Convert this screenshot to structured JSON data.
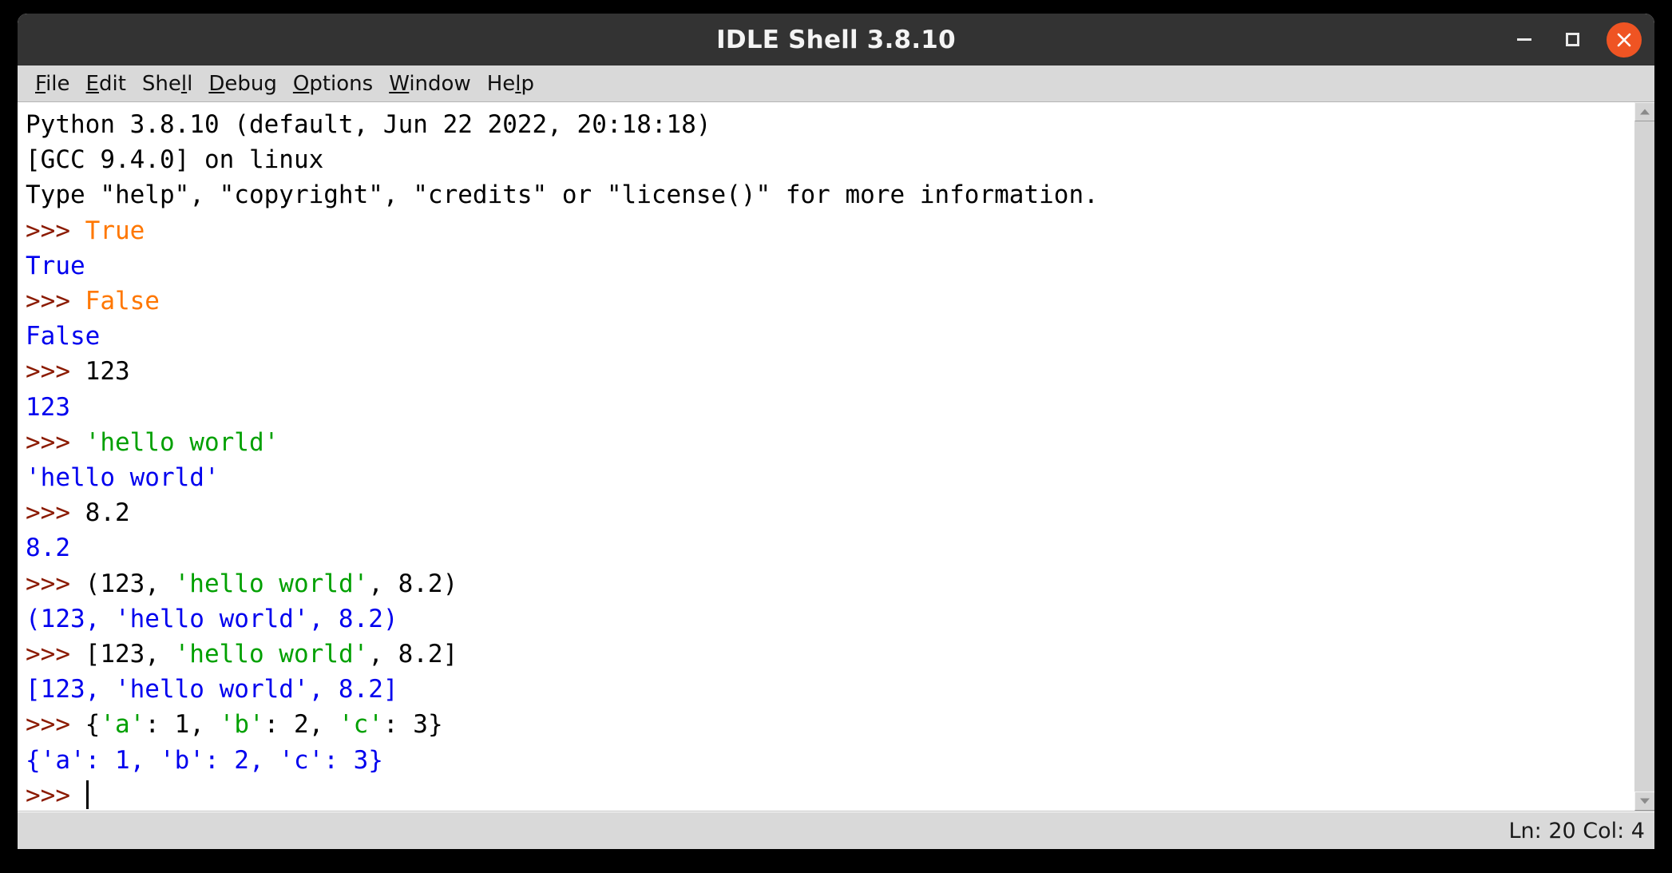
{
  "window": {
    "title": "IDLE Shell 3.8.10",
    "controls": {
      "minimize_label": "Minimize",
      "maximize_label": "Maximize",
      "close_label": "Close"
    },
    "colors": {
      "titlebar_bg": "#333333",
      "titlebar_fg": "#f4f4f4",
      "close_button": "#ef5423",
      "chrome_bg": "#d9d9d9",
      "text_bg": "#ffffff"
    }
  },
  "menubar": {
    "items": [
      {
        "label": "File",
        "pre": "",
        "mnemonic": "F",
        "post": "ile"
      },
      {
        "label": "Edit",
        "pre": "",
        "mnemonic": "E",
        "post": "dit"
      },
      {
        "label": "Shell",
        "pre": "She",
        "mnemonic": "l",
        "post": "l"
      },
      {
        "label": "Debug",
        "pre": "",
        "mnemonic": "D",
        "post": "ebug"
      },
      {
        "label": "Options",
        "pre": "",
        "mnemonic": "O",
        "post": "ptions"
      },
      {
        "label": "Window",
        "pre": "",
        "mnemonic": "W",
        "post": "indow"
      },
      {
        "label": "Help",
        "pre": "He",
        "mnemonic": "l",
        "post": "p"
      }
    ]
  },
  "shell": {
    "syntax_colors": {
      "prompt": "#8b1a00",
      "keyword": "#ff7700",
      "string": "#00a000",
      "output": "#0000ee",
      "default": "#000000"
    },
    "lines": [
      {
        "id": "banner-1",
        "spans": [
          {
            "text": "Python 3.8.10 (default, Jun 22 2022, 20:18:18)",
            "color": "default"
          }
        ]
      },
      {
        "id": "banner-2",
        "spans": [
          {
            "text": "[GCC 9.4.0] on linux",
            "color": "default"
          }
        ]
      },
      {
        "id": "banner-3",
        "spans": [
          {
            "text": "Type \"help\", \"copyright\", \"credits\" or \"license()\" for more information.",
            "color": "default"
          }
        ]
      },
      {
        "id": "input-true",
        "spans": [
          {
            "text": ">>> ",
            "color": "prompt"
          },
          {
            "text": "True",
            "color": "keyword"
          }
        ]
      },
      {
        "id": "output-true",
        "spans": [
          {
            "text": "True",
            "color": "output"
          }
        ]
      },
      {
        "id": "input-false",
        "spans": [
          {
            "text": ">>> ",
            "color": "prompt"
          },
          {
            "text": "False",
            "color": "keyword"
          }
        ]
      },
      {
        "id": "output-false",
        "spans": [
          {
            "text": "False",
            "color": "output"
          }
        ]
      },
      {
        "id": "input-int",
        "spans": [
          {
            "text": ">>> ",
            "color": "prompt"
          },
          {
            "text": "123",
            "color": "default"
          }
        ]
      },
      {
        "id": "output-int",
        "spans": [
          {
            "text": "123",
            "color": "output"
          }
        ]
      },
      {
        "id": "input-str",
        "spans": [
          {
            "text": ">>> ",
            "color": "prompt"
          },
          {
            "text": "'hello world'",
            "color": "string"
          }
        ]
      },
      {
        "id": "output-str",
        "spans": [
          {
            "text": "'hello world'",
            "color": "output"
          }
        ]
      },
      {
        "id": "input-float",
        "spans": [
          {
            "text": ">>> ",
            "color": "prompt"
          },
          {
            "text": "8.2",
            "color": "default"
          }
        ]
      },
      {
        "id": "output-float",
        "spans": [
          {
            "text": "8.2",
            "color": "output"
          }
        ]
      },
      {
        "id": "input-tuple",
        "spans": [
          {
            "text": ">>> ",
            "color": "prompt"
          },
          {
            "text": "(123, ",
            "color": "default"
          },
          {
            "text": "'hello world'",
            "color": "string"
          },
          {
            "text": ", 8.2)",
            "color": "default"
          }
        ]
      },
      {
        "id": "output-tuple",
        "spans": [
          {
            "text": "(123, 'hello world', 8.2)",
            "color": "output"
          }
        ]
      },
      {
        "id": "input-list",
        "spans": [
          {
            "text": ">>> ",
            "color": "prompt"
          },
          {
            "text": "[123, ",
            "color": "default"
          },
          {
            "text": "'hello world'",
            "color": "string"
          },
          {
            "text": ", 8.2]",
            "color": "default"
          }
        ]
      },
      {
        "id": "output-list",
        "spans": [
          {
            "text": "[123, 'hello world', 8.2]",
            "color": "output"
          }
        ]
      },
      {
        "id": "input-dict",
        "spans": [
          {
            "text": ">>> ",
            "color": "prompt"
          },
          {
            "text": "{",
            "color": "default"
          },
          {
            "text": "'a'",
            "color": "string"
          },
          {
            "text": ": 1, ",
            "color": "default"
          },
          {
            "text": "'b'",
            "color": "string"
          },
          {
            "text": ": 2, ",
            "color": "default"
          },
          {
            "text": "'c'",
            "color": "string"
          },
          {
            "text": ": 3}",
            "color": "default"
          }
        ]
      },
      {
        "id": "output-dict",
        "spans": [
          {
            "text": "{'a': 1, 'b': 2, 'c': 3}",
            "color": "output"
          }
        ]
      },
      {
        "id": "input-active",
        "cursor": true,
        "spans": [
          {
            "text": ">>> ",
            "color": "prompt"
          }
        ]
      }
    ]
  },
  "scrollbar": {
    "up_arrow": "scroll-up-icon",
    "down_arrow": "scroll-down-icon"
  },
  "statusbar": {
    "position": "Ln: 20 Col: 4"
  }
}
